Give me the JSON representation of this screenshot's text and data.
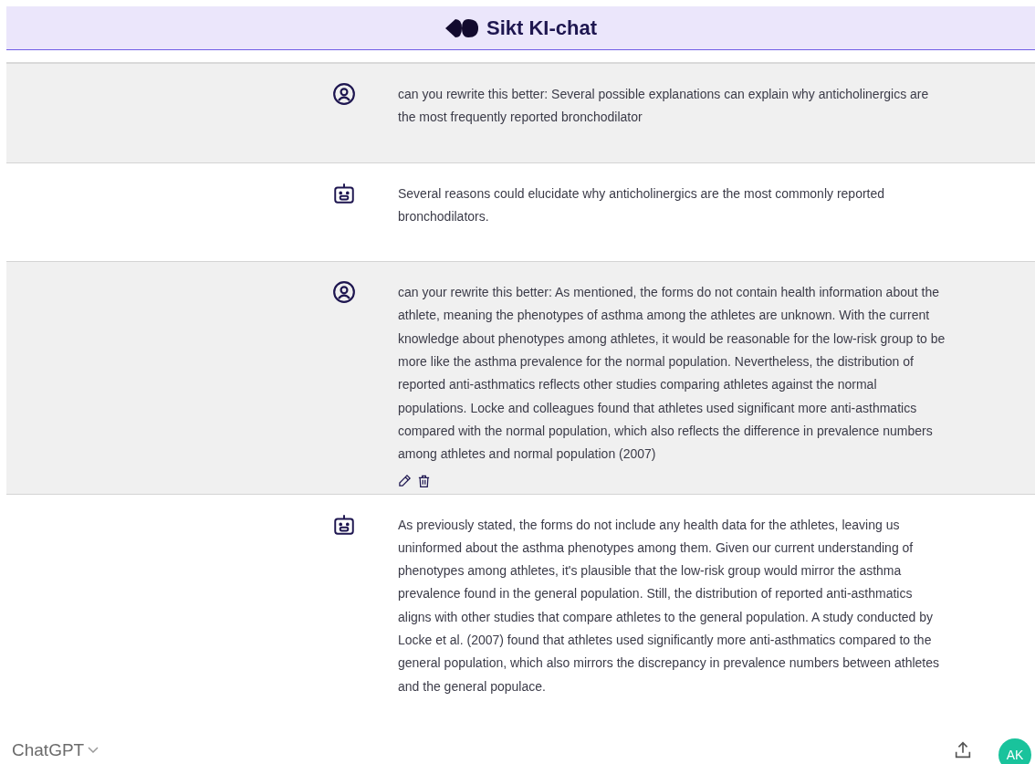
{
  "header": {
    "title": "Sikt KI-chat"
  },
  "messages": [
    {
      "kind": "user",
      "text": "can you rewrite this better: Several possible explanations can explain why anticholinergics are the most frequently reported bronchodilator",
      "actions": false
    },
    {
      "kind": "assistant",
      "text": "Several reasons could elucidate why anticholinergics are the most commonly reported bronchodilators.",
      "actions": false
    },
    {
      "kind": "user",
      "text": "can your rewrite this better: As mentioned, the forms do not contain health information about the athlete, meaning the phenotypes of asthma among the athletes are unknown. With the current knowledge about phenotypes among athletes, it would be reasonable for the low-risk group to be more like the asthma prevalence for the normal population. Nevertheless, the distribution of reported anti-asthmatics reflects other studies comparing athletes against the normal populations. Locke and colleagues found that athletes used significant more anti-asthmatics compared with the normal population, which also reflects the difference in prevalence numbers among athletes and normal population (2007)",
      "actions": true
    },
    {
      "kind": "assistant",
      "text": "As previously stated, the forms do not include any health data for the athletes, leaving us uninformed about the asthma phenotypes among them. Given our current understanding of phenotypes among athletes, it's plausible that the low-risk group would mirror the asthma prevalence found in the general population. Still, the distribution of reported anti-asthmatics aligns with other studies that compare athletes to the general population. A study conducted by Locke et al. (2007) found that athletes used significantly more anti-asthmatics compared to the general population, which also mirrors the discrepancy in prevalence numbers between athletes and the general populace.",
      "actions": false
    }
  ],
  "bottom_bar": {
    "model": "ChatGPT",
    "avatar": "AK"
  }
}
